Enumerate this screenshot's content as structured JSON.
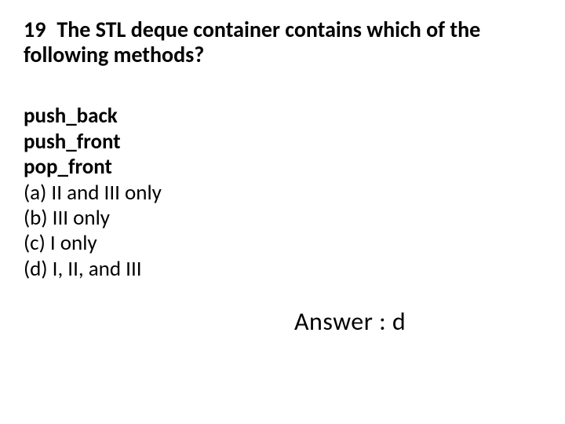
{
  "question": {
    "number": "19",
    "text": "The STL deque container contains which of the following methods?"
  },
  "methods": {
    "m1": "push_back",
    "m2": "push_front",
    "m3": "pop_front"
  },
  "choices": {
    "a": "(a) II and III only",
    "b": "(b) III only",
    "c": "(c) I only",
    "d": "(d) I, II, and III"
  },
  "answer": "Answer : d"
}
